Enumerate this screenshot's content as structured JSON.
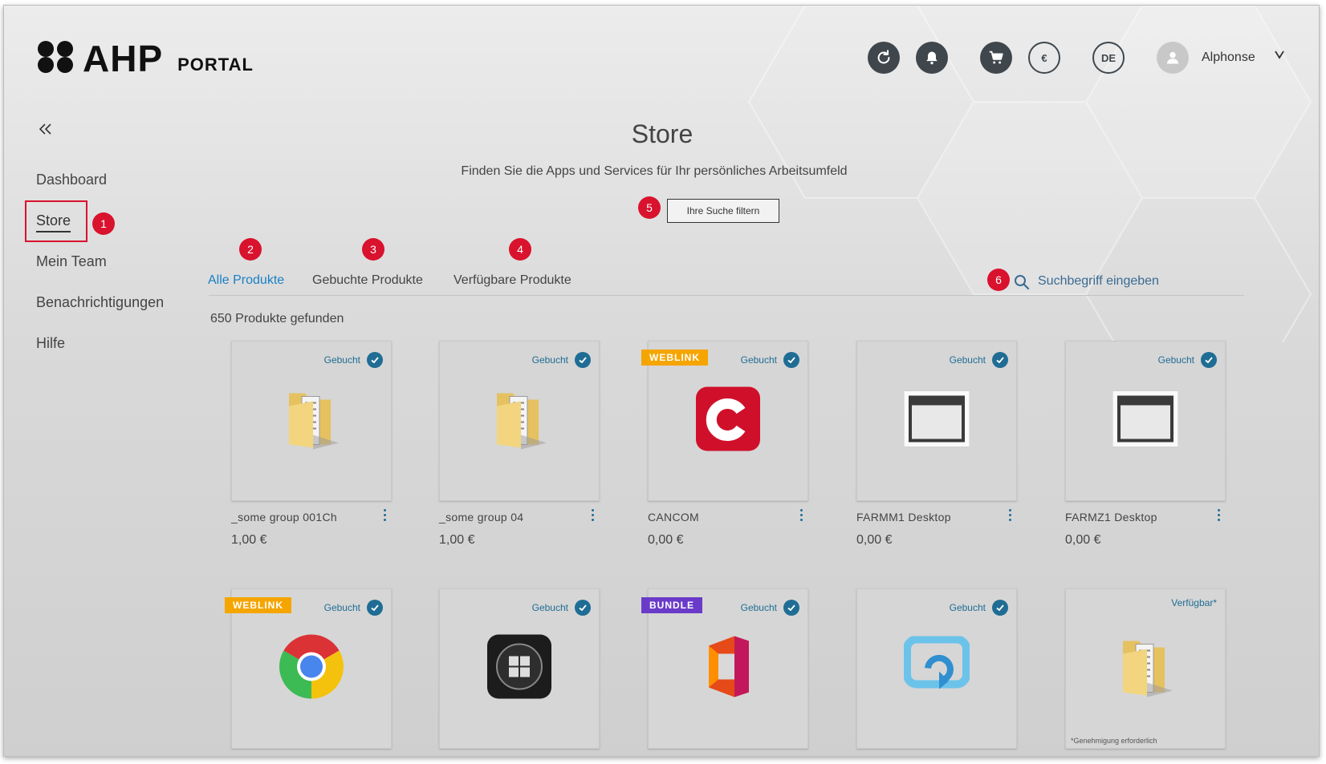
{
  "header": {
    "logo_text": "AHP",
    "logo_sub": "PORTAL",
    "currency_label": "€",
    "language_label": "DE",
    "user_name": "Alphonse"
  },
  "sidebar": {
    "items": [
      {
        "label": "Dashboard"
      },
      {
        "label": "Store"
      },
      {
        "label": "Mein Team"
      },
      {
        "label": "Benachrichtigungen"
      },
      {
        "label": "Hilfe"
      }
    ]
  },
  "markers": [
    "1",
    "2",
    "3",
    "4",
    "5",
    "6"
  ],
  "main": {
    "title": "Store",
    "subtitle": "Finden Sie die Apps und Services für Ihr persönliches Arbeitsumfeld",
    "filter_button": "Ihre Suche filtern",
    "tabs": [
      {
        "label": "Alle Produkte"
      },
      {
        "label": "Gebuchte Produkte"
      },
      {
        "label": "Verfügbare Produkte"
      }
    ],
    "search_placeholder": "Suchbegriff eingeben",
    "result_count": "650 Produkte gefunden"
  },
  "products": [
    {
      "name": "_some group 001Ch",
      "price": "1,00 €",
      "status": "Gebucht",
      "icon": "folder-icon"
    },
    {
      "name": "_some group 04",
      "price": "1,00 €",
      "status": "Gebucht",
      "icon": "folder-icon"
    },
    {
      "name": "CANCOM",
      "price": "0,00 €",
      "status": "Gebucht",
      "badge": "WEBLINK",
      "icon": "cancom-icon"
    },
    {
      "name": "FARMM1 Desktop",
      "price": "0,00 €",
      "status": "Gebucht",
      "icon": "desktop-window-icon"
    },
    {
      "name": "FARMZ1 Desktop",
      "price": "0,00 €",
      "status": "Gebucht",
      "icon": "desktop-window-icon"
    },
    {
      "status": "Gebucht",
      "badge": "WEBLINK",
      "icon": "chrome-icon"
    },
    {
      "status": "Gebucht",
      "icon": "windows-icon"
    },
    {
      "status": "Gebucht",
      "badge": "BUNDLE",
      "icon": "office-icon"
    },
    {
      "status": "Gebucht",
      "icon": "remote-desktop-icon"
    },
    {
      "status": "Verfügbar*",
      "icon": "folder-icon",
      "footnote": "*Genehmigung erforderlich"
    }
  ],
  "colors": {
    "accent": "#1a7fc4",
    "status": "#1f6d94",
    "marker": "#d9122e",
    "weblink": "#f5a500",
    "bundle": "#6a3bc9"
  }
}
